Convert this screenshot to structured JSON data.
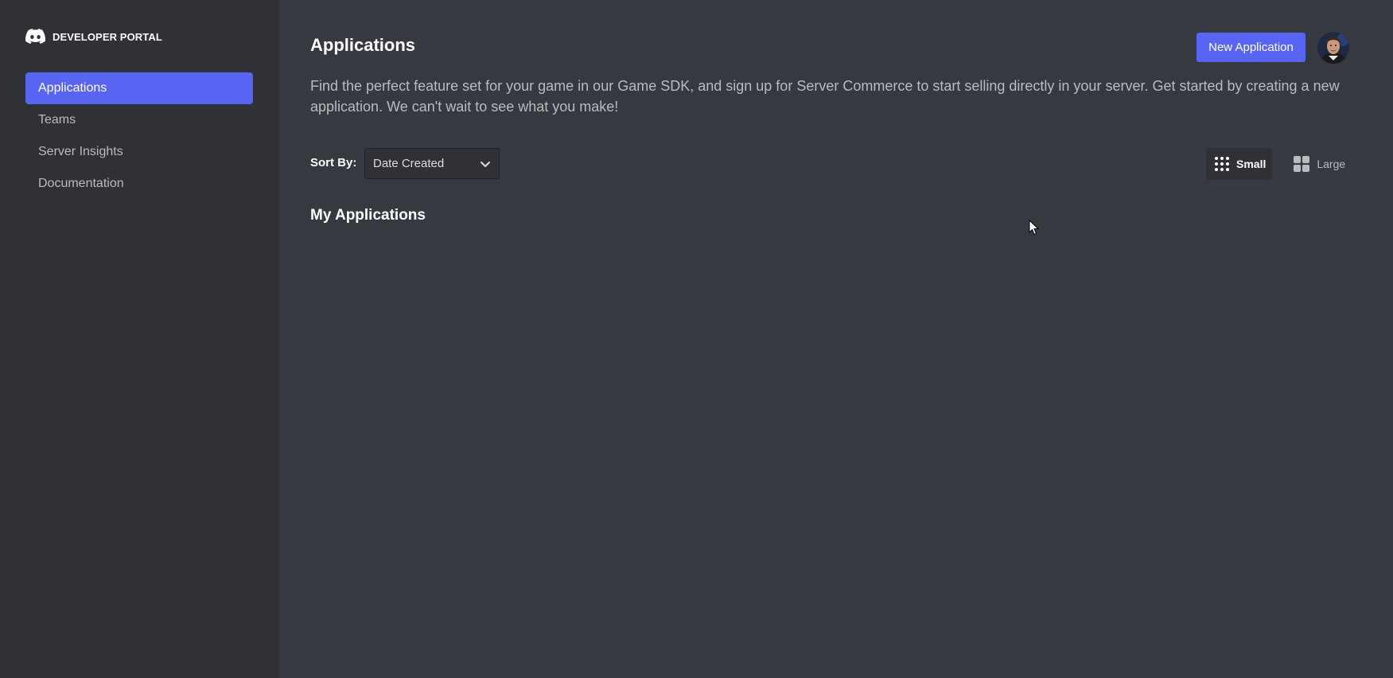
{
  "brand": {
    "icon": "discord-logo-icon",
    "label": "DEVELOPER PORTAL"
  },
  "sidebar": {
    "items": [
      {
        "label": "Applications",
        "active": true
      },
      {
        "label": "Teams",
        "active": false
      },
      {
        "label": "Server Insights",
        "active": false
      },
      {
        "label": "Documentation",
        "active": false
      }
    ]
  },
  "header": {
    "title": "Applications",
    "new_app_label": "New Application",
    "avatar_icon": "user-avatar"
  },
  "description": "Find the perfect feature set for your game in our Game SDK, and sign up for Server Commerce to start selling directly in your server. Get started by creating a new application. We can't wait to see what you make!",
  "sort": {
    "label": "Sort By:",
    "value": "Date Created"
  },
  "view_toggle": {
    "small_label": "Small",
    "large_label": "Large",
    "selected": "Small"
  },
  "section": {
    "title": "My Applications"
  },
  "colors": {
    "accent": "#5865f2",
    "sidebar_bg": "#2f3136",
    "main_bg": "#36393f"
  }
}
